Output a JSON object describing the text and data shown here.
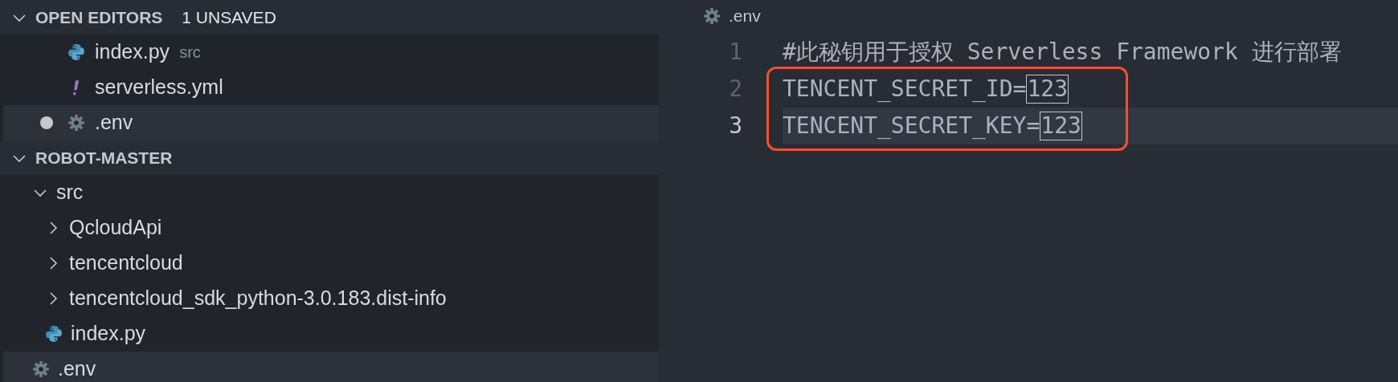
{
  "open_editors": {
    "title": "OPEN EDITORS",
    "badge": "1 UNSAVED",
    "expanded": true,
    "items": [
      {
        "name": "index.py",
        "detail": "src",
        "kind": "python",
        "unsaved": false,
        "selected": false
      },
      {
        "name": "serverless.yml",
        "kind": "yaml",
        "unsaved": false,
        "selected": false
      },
      {
        "name": ".env",
        "kind": "gear",
        "unsaved": true,
        "selected": true
      }
    ]
  },
  "explorer": {
    "title": "ROBOT-MASTER",
    "expanded": true,
    "tree": [
      {
        "name": "src",
        "kind": "folder",
        "expanded": true,
        "selected": false,
        "children": [
          {
            "name": "QcloudApi",
            "kind": "folder",
            "expanded": false,
            "selected": false
          },
          {
            "name": "tencentcloud",
            "kind": "folder",
            "expanded": false,
            "selected": false
          },
          {
            "name": "tencentcloud_sdk_python-3.0.183.dist-info",
            "kind": "folder",
            "expanded": false,
            "selected": false
          },
          {
            "name": "index.py",
            "kind": "python",
            "selected": false
          }
        ]
      },
      {
        "name": ".env",
        "kind": "gear",
        "selected": true
      }
    ]
  },
  "editor": {
    "tab": {
      "name": ".env",
      "kind": "gear"
    },
    "lines": [
      {
        "number": "1",
        "current": false,
        "boxed": false,
        "segments": [
          {
            "text": "#此秘钥用于授权 Serverless Framework 进行部署",
            "highlighted": false
          }
        ]
      },
      {
        "number": "2",
        "current": false,
        "boxed": true,
        "segments": [
          {
            "text": "TENCENT_SECRET_ID=",
            "highlighted": false
          },
          {
            "text": "123",
            "highlighted": true
          }
        ]
      },
      {
        "number": "3",
        "current": true,
        "boxed": true,
        "segments": [
          {
            "text": "TENCENT_SECRET_KEY=",
            "highlighted": false
          },
          {
            "text": "123",
            "highlighted": true
          }
        ]
      }
    ]
  }
}
